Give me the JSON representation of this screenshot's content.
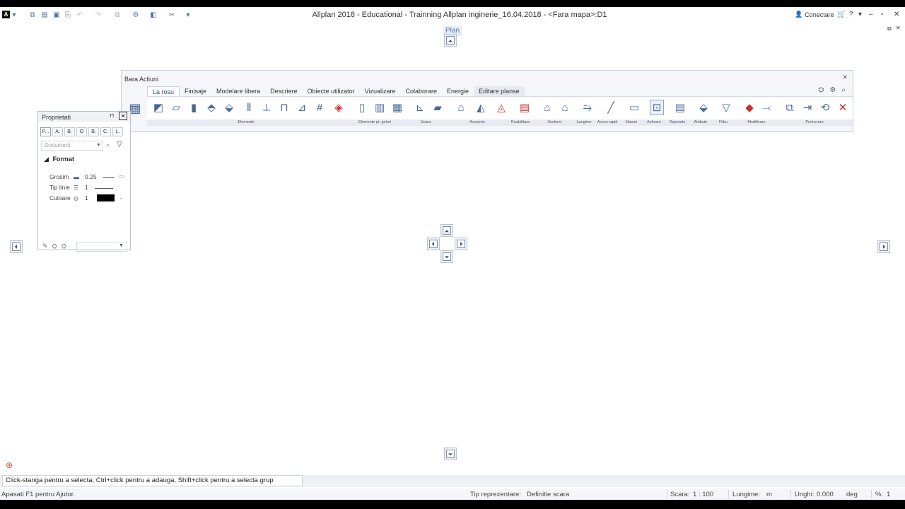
{
  "window": {
    "title": "Allplan 2018 - Educational - Trainning Allplan inginerie_16.04.2018 - <Fara mapa>:D1",
    "logo": "A",
    "connect_label": "Conectare"
  },
  "plan_tab": {
    "label": "Plan"
  },
  "actionbar": {
    "title": "Bara Actiuni",
    "tabs": [
      {
        "label": "La rosu"
      },
      {
        "label": "Finisaje"
      },
      {
        "label": "Modelare libera"
      },
      {
        "label": "Descriere"
      },
      {
        "label": "Obiecte utilizator"
      },
      {
        "label": "Vizualizare"
      },
      {
        "label": "Colaborare"
      },
      {
        "label": "Energie"
      },
      {
        "label": "Editare planse"
      }
    ],
    "groups": [
      {
        "label": "Elemente"
      },
      {
        "label": "Elemente pt. goluri"
      },
      {
        "label": "Scara"
      },
      {
        "label": "Acoperis"
      },
      {
        "label": "Reabilitare"
      },
      {
        "label": "Sectiuni"
      },
      {
        "label": "Lungime"
      },
      {
        "label": "Acces rapid"
      },
      {
        "label": "Masuri"
      },
      {
        "label": "Activare"
      },
      {
        "label": "Rapoarte"
      },
      {
        "label": "Atribute"
      },
      {
        "label": "Filtru"
      },
      {
        "label": "Modificare"
      },
      {
        "label": "Prelucrare"
      }
    ]
  },
  "properties": {
    "title": "Proprietati",
    "tabs": [
      {
        "label": "P..."
      },
      {
        "label": "A."
      },
      {
        "label": "B."
      },
      {
        "label": "O"
      },
      {
        "label": "B."
      },
      {
        "label": "C."
      },
      {
        "label": "L."
      }
    ],
    "document_placeholder": "Document",
    "section": "Format",
    "rows": [
      {
        "label": "Grosim",
        "value": "0.25"
      },
      {
        "label": "Tip linie",
        "value": "1"
      },
      {
        "label": "Culoare",
        "value": "1",
        "color": "#000000"
      }
    ]
  },
  "hint": "Click-stanga pentru a selecta, Ctrl+click pentru a adauga, Shift+click pentru a selecta grup",
  "status": {
    "help": "Apasati F1 pentru Ajutor.",
    "repr_label": "Tip reprezentare:",
    "repr_value": "Definitie scara",
    "scale_label": "Scara:",
    "scale_value": "1 : 100",
    "length_label": "Lungime:",
    "length_value": "m",
    "angle_label": "Unghi:",
    "angle_value": "0.000",
    "angle_unit": "deg",
    "percent_label": "%:",
    "percent_value": "1"
  }
}
